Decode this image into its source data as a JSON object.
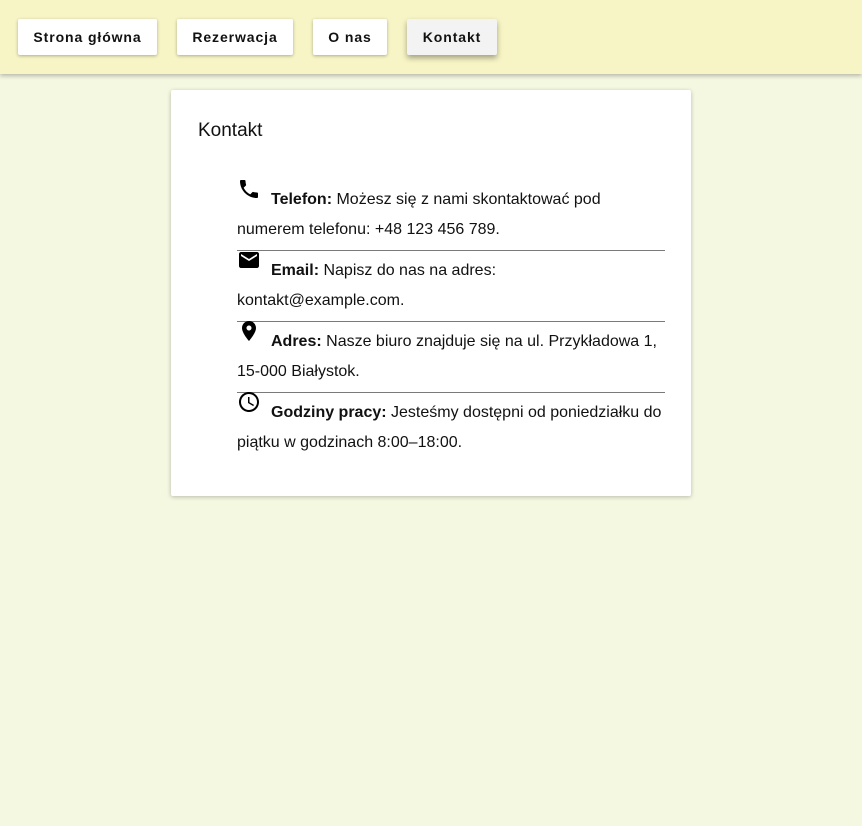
{
  "nav": {
    "home": "Strona główna",
    "reservation": "Rezerwacja",
    "about": "O nas",
    "contact": "Kontakt"
  },
  "card": {
    "title": "Kontakt",
    "items": [
      {
        "icon": "phone-icon",
        "label": "Telefon:",
        "text": " Możesz się z nami skontaktować pod numerem telefonu: +48 123 456 789."
      },
      {
        "icon": "email-icon",
        "label": "Email:",
        "text": " Napisz do nas na adres: kontakt@example.com."
      },
      {
        "icon": "location-pin-icon",
        "label": "Adres:",
        "text": " Nasze biuro znajduje się na ul. Przykładowa 1, 15-000 Białystok."
      },
      {
        "icon": "clock-icon",
        "label": "Godziny pracy:",
        "text": " Jesteśmy dostępni od poniedziałku do piątku w godzinach 8:00–18:00."
      }
    ]
  },
  "colors": {
    "page_background": "#f4f8e1",
    "header_background": "#f7f5c5",
    "card_background": "#ffffff",
    "active_button": "#f3f3f3"
  }
}
